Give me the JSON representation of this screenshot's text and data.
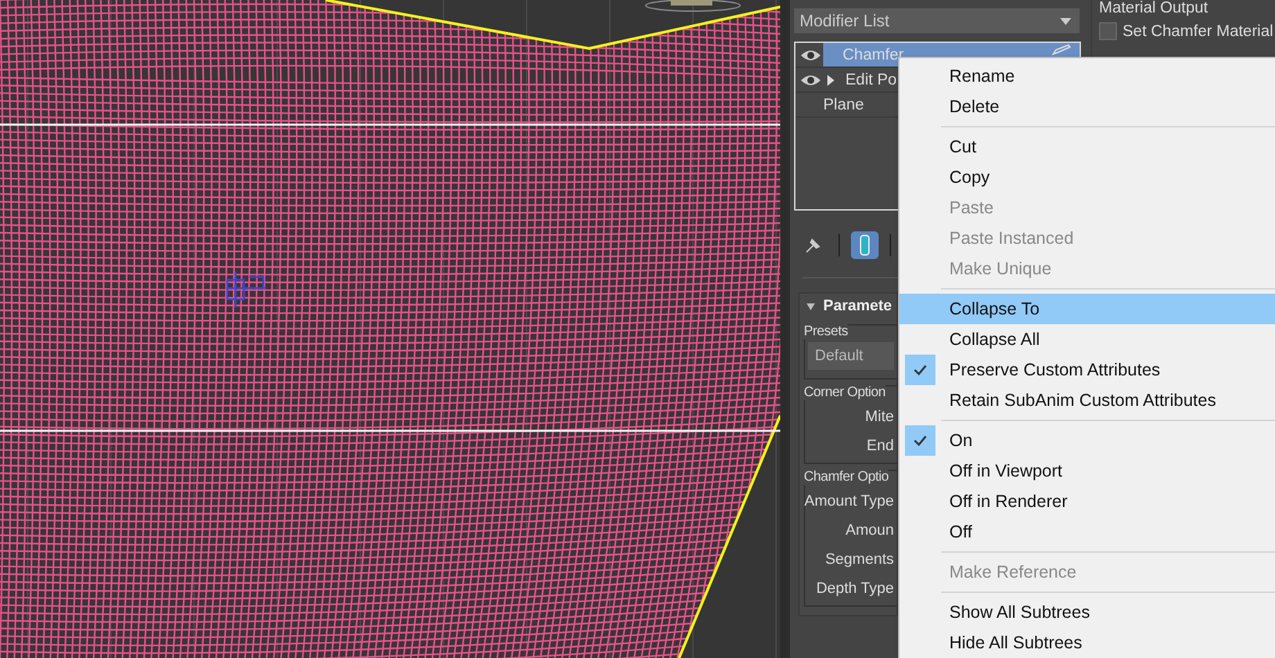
{
  "modifier_panel": {
    "modifier_list": {
      "label": "Modifier List"
    },
    "stack": [
      {
        "name": "Chamfer",
        "eye": true,
        "expandable": false,
        "selected": true,
        "edit_icon": true
      },
      {
        "name": "Edit Po",
        "eye": true,
        "expandable": true,
        "selected": false
      },
      {
        "name": "Plane",
        "eye": false,
        "expandable": false,
        "selected": false
      }
    ],
    "toolbar": [
      {
        "kind": "pin",
        "selected": false
      },
      {
        "kind": "modifier",
        "selected": true
      }
    ],
    "rollout": {
      "title": "Paramete",
      "expanded": true,
      "groups": [
        {
          "title": "Presets",
          "kind": "dropdown",
          "value": "Default"
        },
        {
          "title": "Corner Option",
          "kind": "labels",
          "labels": [
            "Mite",
            "End"
          ]
        },
        {
          "title": "Chamfer Optio",
          "kind": "labels",
          "labels": [
            "Amount Type",
            "Amoun",
            "Segments",
            "Depth Type"
          ]
        }
      ]
    }
  },
  "material_output": {
    "title": "Material Output",
    "checkbox": {
      "label": "Set Chamfer Material",
      "checked": false
    }
  },
  "context_menu": [
    {
      "kind": "item",
      "label": "Rename",
      "disabled": false,
      "checked": false,
      "selected": false
    },
    {
      "kind": "item",
      "label": "Delete",
      "disabled": false,
      "checked": false,
      "selected": false
    },
    {
      "kind": "separator"
    },
    {
      "kind": "item",
      "label": "Cut",
      "disabled": false,
      "checked": false,
      "selected": false
    },
    {
      "kind": "item",
      "label": "Copy",
      "disabled": false,
      "checked": false,
      "selected": false
    },
    {
      "kind": "item",
      "label": "Paste",
      "disabled": true,
      "checked": false,
      "selected": false
    },
    {
      "kind": "item",
      "label": "Paste Instanced",
      "disabled": true,
      "checked": false,
      "selected": false
    },
    {
      "kind": "item",
      "label": "Make Unique",
      "disabled": true,
      "checked": false,
      "selected": false
    },
    {
      "kind": "separator"
    },
    {
      "kind": "item",
      "label": "Collapse To",
      "disabled": false,
      "checked": false,
      "selected": true
    },
    {
      "kind": "item",
      "label": "Collapse All",
      "disabled": false,
      "checked": false,
      "selected": false
    },
    {
      "kind": "item",
      "label": "Preserve Custom Attributes",
      "disabled": false,
      "checked": true,
      "selected": false
    },
    {
      "kind": "item",
      "label": "Retain SubAnim Custom Attributes",
      "disabled": false,
      "checked": false,
      "selected": false
    },
    {
      "kind": "separator"
    },
    {
      "kind": "item",
      "label": "On",
      "disabled": false,
      "checked": true,
      "selected": false
    },
    {
      "kind": "item",
      "label": "Off in Viewport",
      "disabled": false,
      "checked": false,
      "selected": false
    },
    {
      "kind": "item",
      "label": "Off in Renderer",
      "disabled": false,
      "checked": false,
      "selected": false
    },
    {
      "kind": "item",
      "label": "Off",
      "disabled": false,
      "checked": false,
      "selected": false
    },
    {
      "kind": "separator"
    },
    {
      "kind": "item",
      "label": "Make Reference",
      "disabled": true,
      "checked": false,
      "selected": false
    },
    {
      "kind": "separator"
    },
    {
      "kind": "item",
      "label": "Show All Subtrees",
      "disabled": false,
      "checked": false,
      "selected": false
    },
    {
      "kind": "item",
      "label": "Hide All Subtrees",
      "disabled": false,
      "checked": false,
      "selected": false
    }
  ]
}
